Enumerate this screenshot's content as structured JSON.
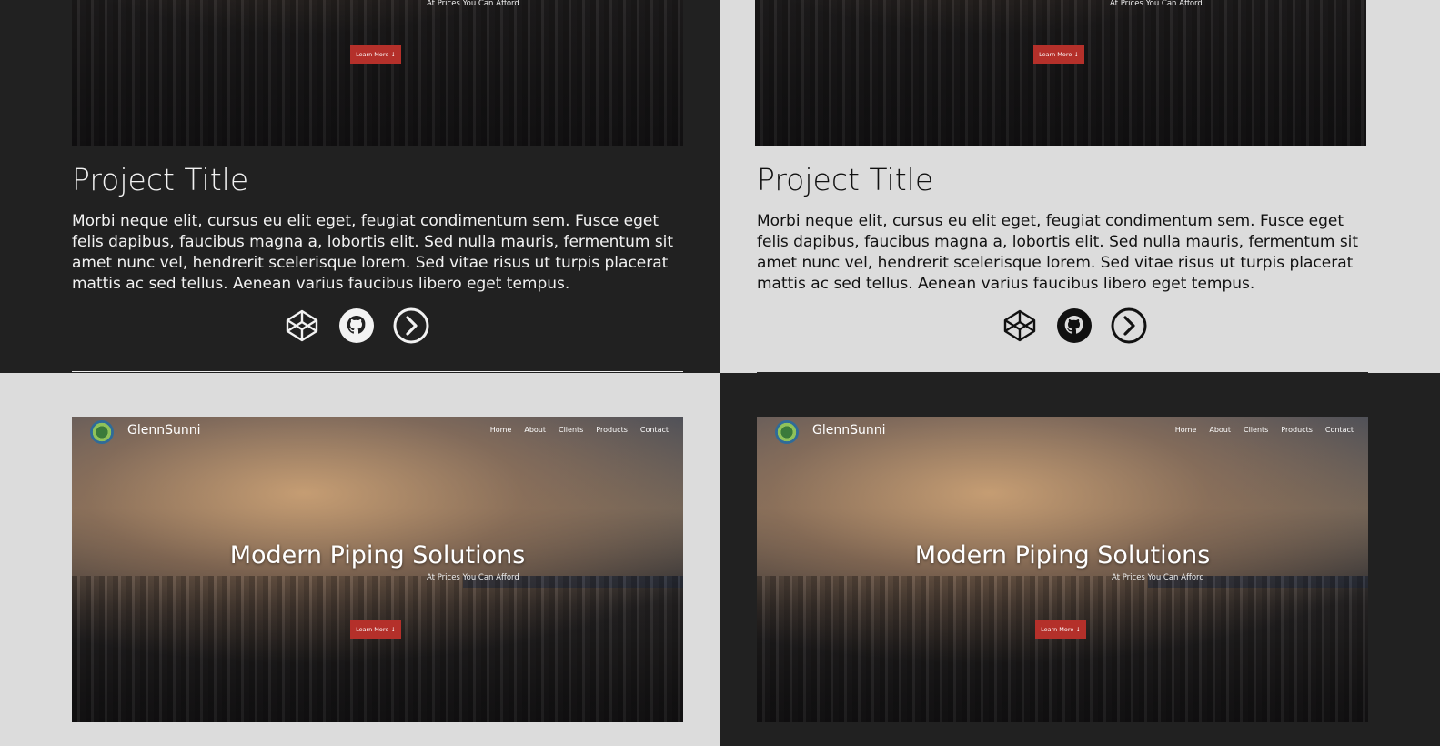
{
  "preview": {
    "brand": "GlennSunni",
    "nav": [
      "Home",
      "About",
      "Clients",
      "Products",
      "Contact"
    ],
    "hero_title": "Modern Piping Solutions",
    "hero_subtitle": "At Prices You Can Afford",
    "cta": "Learn More ↓"
  },
  "card": {
    "title": "Project Title",
    "description": "Morbi neque elit, cursus eu elit eget, feugiat condimentum sem. Fusce eget felis dapibus, faucibus magna a, lobortis elit. Sed nulla mauris, fermentum sit amet nunc vel, hendrerit scelerisque lorem. Sed vitae risus ut turpis placerat mattis ac sed tellus. Aenean varius faucibus libero eget tempus.",
    "icons": [
      "codepen-icon",
      "github-icon",
      "arrow-right-circle-icon"
    ]
  },
  "colors": {
    "dark_bg": "#212121",
    "light_bg": "#dcdcdc",
    "cta": "#b4302a"
  }
}
